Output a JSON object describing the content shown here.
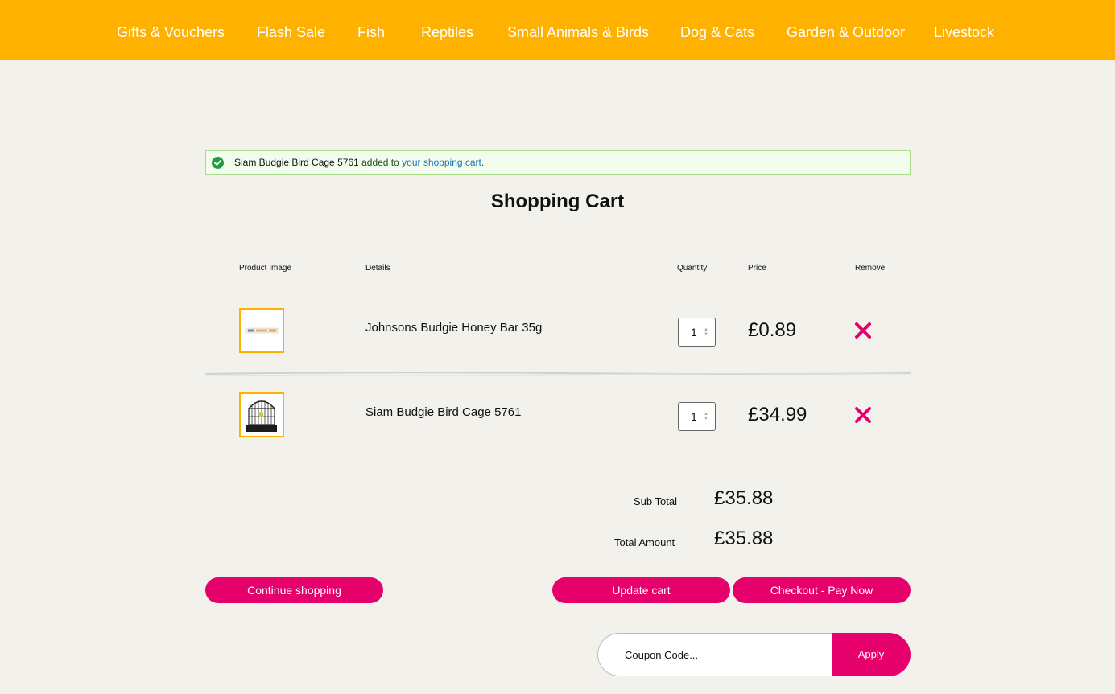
{
  "nav": {
    "items": [
      {
        "label": "Gifts & Vouchers"
      },
      {
        "label": "Flash Sale"
      },
      {
        "label": "Fish"
      },
      {
        "label": "Reptiles"
      },
      {
        "label": "Small Animals & Birds"
      },
      {
        "label": "Dog & Cats"
      },
      {
        "label": "Garden & Outdoor"
      },
      {
        "label": "Livestock"
      }
    ]
  },
  "notice": {
    "icon": "check-circle-icon",
    "item_name": "Siam Budgie Bird Cage 5761",
    "text": " added to ",
    "link": "your shopping cart",
    "end": "."
  },
  "cart": {
    "title": "Shopping Cart",
    "headers": {
      "image": "Product Image",
      "details": "Details",
      "quantity": "Quantity",
      "price": "Price",
      "remove": "Remove"
    },
    "items": [
      {
        "name": "Johnsons Budgie Honey Bar 35g",
        "quantity": "1",
        "price": "£0.89",
        "image_icon": "honey-bar-image",
        "remove_icon": "close-icon"
      },
      {
        "name": "Siam Budgie Bird Cage 5761",
        "quantity": "1",
        "price": "£34.99",
        "image_icon": "bird-cage-image",
        "remove_icon": "close-icon"
      }
    ],
    "subtotal_label": "Sub Total",
    "subtotal_value": "£35.88",
    "total_label": "Total Amount",
    "total_value": "£35.88"
  },
  "actions": {
    "continue": "Continue shopping",
    "update": "Update cart",
    "checkout": "Checkout - Pay Now"
  },
  "coupon": {
    "placeholder": "Coupon Code...",
    "value": "",
    "apply": "Apply"
  },
  "colors": {
    "nav_bg": "#ffb100",
    "accent": "#e5006b",
    "page_bg": "#f2f1ec",
    "success": "#1e9e3f",
    "link": "#1a73b8"
  }
}
